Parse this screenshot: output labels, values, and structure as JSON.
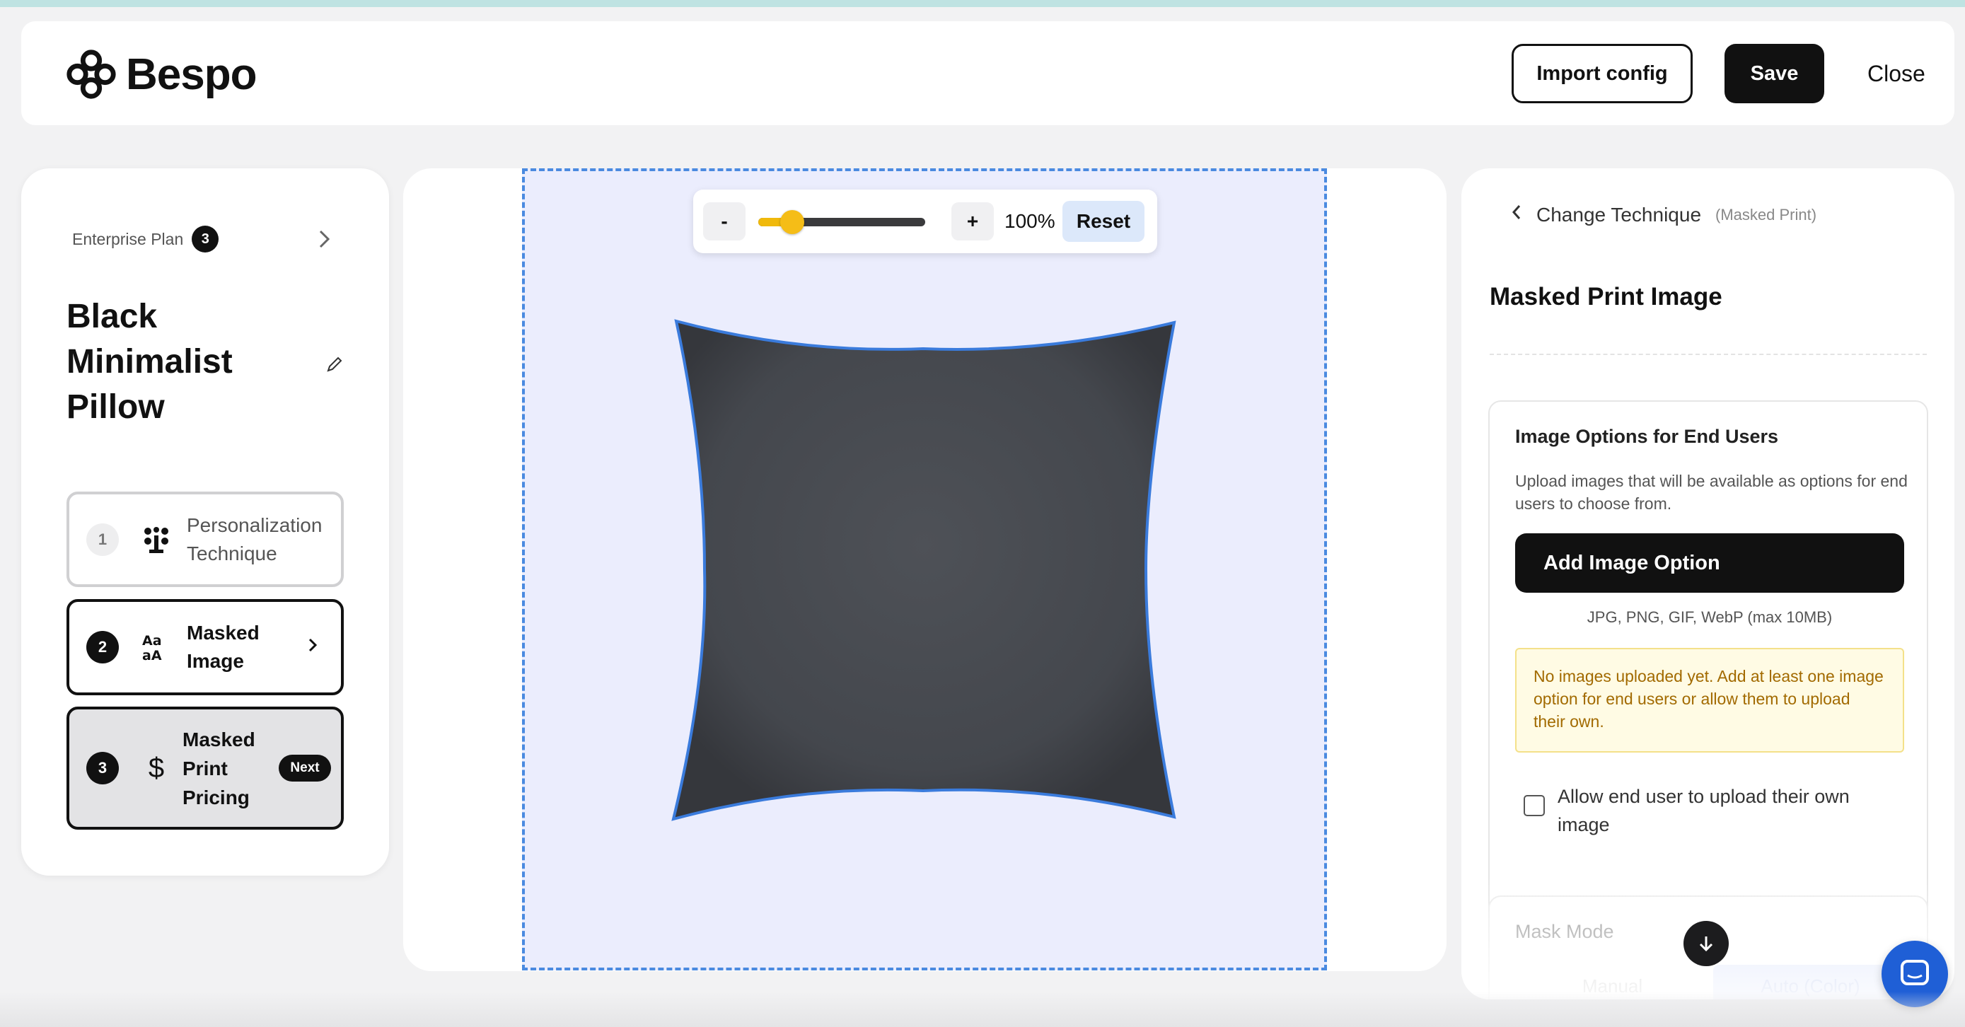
{
  "header": {
    "brand": "Bespo",
    "import_label": "Import config",
    "save_label": "Save",
    "close_label": "Close"
  },
  "sidebar": {
    "plan_label": "Enterprise Plan",
    "plan_count": "3",
    "product_title": "Black Minimalist Pillow",
    "steps": [
      {
        "number": "1",
        "label": "Personalization Technique",
        "icon": "tree-nodes-icon",
        "state": "completed"
      },
      {
        "number": "2",
        "label": "Masked Image",
        "icon": "typography-icon",
        "state": "active"
      },
      {
        "number": "3",
        "label": "Masked Print Pricing",
        "icon": "dollar-icon",
        "state": "next",
        "badge": "Next"
      }
    ]
  },
  "canvas": {
    "zoom_minus": "-",
    "zoom_plus": "+",
    "zoom_value": "100%",
    "zoom_level": 0.25,
    "reset_label": "Reset",
    "product_color": "#4a4d53",
    "mask_outline_color": "#3a7bdc",
    "print_area_color": "#ebedfd"
  },
  "panel": {
    "back_label": "Change Technique",
    "technique_name": "(Masked Print)",
    "section_title": "Masked Print Image",
    "options_title": "Image Options for End Users",
    "options_description": "Upload images that will be available as options for end users to choose from.",
    "add_button_label": "Add Image Option",
    "formats_text": "JPG, PNG, GIF, WebP (max 10MB)",
    "warning_text": "No images uploaded yet. Add at least one image option for end users or allow them to upload their own.",
    "allow_upload_label": "Allow end user to upload their own image",
    "allow_upload_checked": false,
    "mask_mode_title": "Mask Mode",
    "mask_mode_options": [
      "Manual",
      "Auto (Color)"
    ]
  },
  "colors": {
    "accent": "#f5bd17",
    "primary": "#111111",
    "chat": "#1f5fd6",
    "warning_bg": "#fffbe4",
    "warning_text": "#a26a00"
  }
}
